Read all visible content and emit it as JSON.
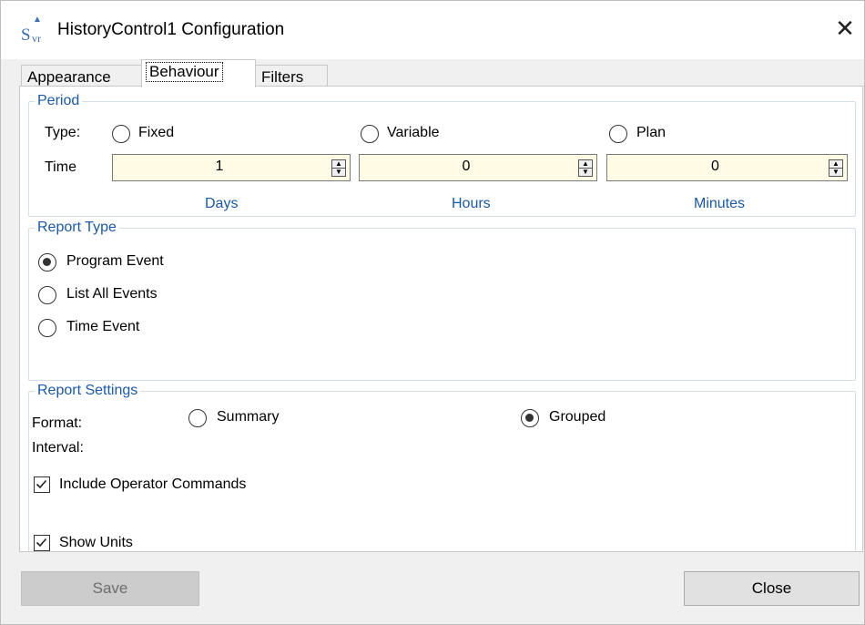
{
  "window": {
    "title": "HistoryControl1 Configuration",
    "close_glyph": "✕"
  },
  "tabs": [
    {
      "label": "Appearance",
      "active": false
    },
    {
      "label": "Behaviour",
      "active": true
    },
    {
      "label": "Filters",
      "active": false
    }
  ],
  "period": {
    "title": "Period",
    "type_label": "Type:",
    "options": [
      {
        "label": "Fixed",
        "checked": false
      },
      {
        "label": "Variable",
        "checked": false
      },
      {
        "label": "Plan",
        "checked": false
      }
    ],
    "time_label": "Time",
    "spinners": [
      {
        "value": "1",
        "unit": "Days"
      },
      {
        "value": "0",
        "unit": "Hours"
      },
      {
        "value": "0",
        "unit": "Minutes"
      }
    ]
  },
  "report_type": {
    "title": "Report Type",
    "options": [
      {
        "label": "Program Event",
        "checked": true
      },
      {
        "label": "List All Events",
        "checked": false
      },
      {
        "label": "Time Event",
        "checked": false
      }
    ]
  },
  "report_settings": {
    "title": "Report Settings",
    "format_label": "Format:",
    "format_options": [
      {
        "label": "Summary",
        "checked": false
      },
      {
        "label": "Grouped",
        "checked": true
      }
    ],
    "interval_label": "Interval:",
    "include_operator_commands": {
      "label": "Include Operator Commands",
      "checked": true
    },
    "show_units": {
      "label": "Show Units",
      "checked": true
    }
  },
  "footer": {
    "save_label": "Save",
    "close_label": "Close"
  },
  "colors": {
    "group_title": "#1a58a8",
    "spinner_bg": "#fffbe5",
    "window_bg": "#f0f0f0"
  },
  "icons": {
    "app": "svr-app-icon",
    "close": "close-icon"
  }
}
